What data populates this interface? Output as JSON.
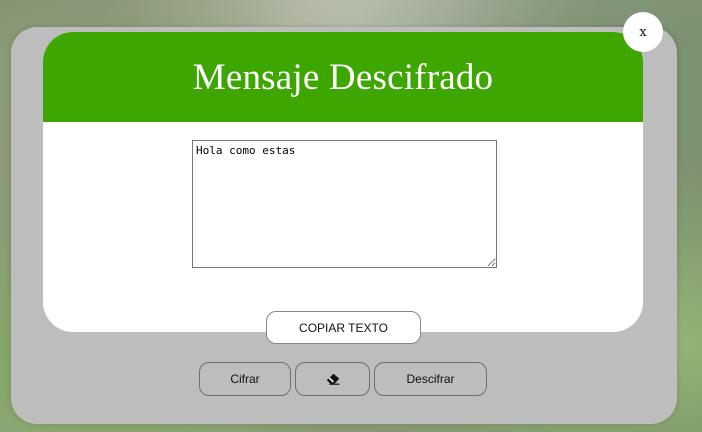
{
  "dialog": {
    "close_label": "x",
    "title": "Mensaje Descifrado",
    "message_text": "Hola como estas",
    "copy_label": "COPIAR TEXTO"
  },
  "actions": {
    "encrypt_label": "Cifrar",
    "clear_icon": "eraser-icon",
    "decrypt_label": "Descifrar"
  },
  "colors": {
    "header_green": "#3da600",
    "card_background": "#ffffff",
    "shell_gray": "#bdbdbd"
  }
}
